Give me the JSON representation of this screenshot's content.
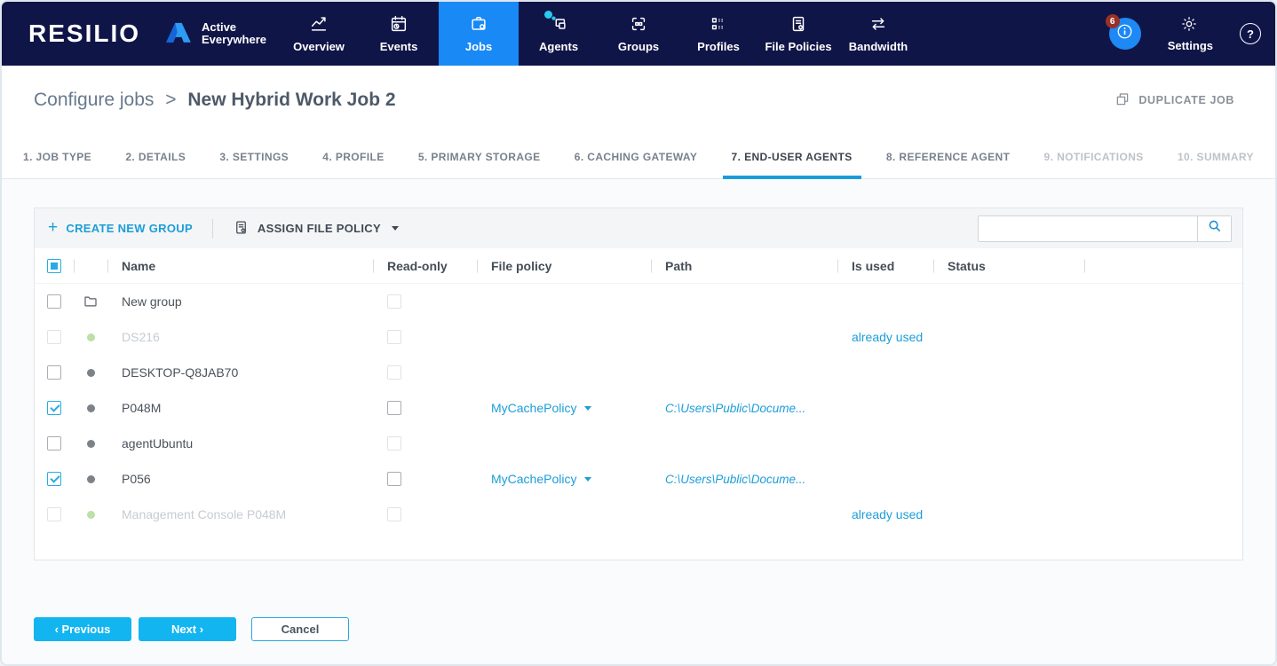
{
  "colors": {
    "navy": "#101548",
    "active_blue": "#1989f5",
    "link_cyan": "#1b9ed9",
    "button_cyan": "#13b5f0",
    "tab_underline": "#1a9cd8",
    "green_dot": "#b3d996",
    "gray_dot": "#7d8288",
    "badge_red": "#993127"
  },
  "brand": {
    "wordmark": "RESILIO",
    "product_line1": "Active",
    "product_line2": "Everywhere"
  },
  "nav": {
    "items": [
      {
        "label": "Overview",
        "icon": "chart-icon",
        "active": false,
        "dot": false
      },
      {
        "label": "Events",
        "icon": "calendar-icon",
        "active": false,
        "dot": false
      },
      {
        "label": "Jobs",
        "icon": "briefcase-icon",
        "active": true,
        "dot": false
      },
      {
        "label": "Agents",
        "icon": "devices-icon",
        "active": false,
        "dot": true
      },
      {
        "label": "Groups",
        "icon": "selection-icon",
        "active": false,
        "dot": false
      },
      {
        "label": "Profiles",
        "icon": "list-icon",
        "active": false,
        "dot": false
      },
      {
        "label": "File Policies",
        "icon": "document-gear-icon",
        "active": false,
        "dot": false
      },
      {
        "label": "Bandwidth",
        "icon": "arrows-icon",
        "active": false,
        "dot": false
      }
    ],
    "notification_badge": "6",
    "settings_label": "Settings",
    "help_glyph": "?"
  },
  "header": {
    "breadcrumb_parent": "Configure jobs",
    "breadcrumb_separator": ">",
    "title": "New Hybrid Work Job 2",
    "duplicate_label": "DUPLICATE JOB"
  },
  "wizard": {
    "steps": [
      {
        "label": "1. JOB TYPE",
        "state": "normal"
      },
      {
        "label": "2. DETAILS",
        "state": "normal"
      },
      {
        "label": "3. SETTINGS",
        "state": "normal"
      },
      {
        "label": "4. PROFILE",
        "state": "normal"
      },
      {
        "label": "5. PRIMARY STORAGE",
        "state": "normal"
      },
      {
        "label": "6. CACHING GATEWAY",
        "state": "normal"
      },
      {
        "label": "7. END-USER AGENTS",
        "state": "active"
      },
      {
        "label": "8. REFERENCE AGENT",
        "state": "normal"
      },
      {
        "label": "9. NOTIFICATIONS",
        "state": "disabled"
      },
      {
        "label": "10. SUMMARY",
        "state": "disabled"
      }
    ]
  },
  "toolbar": {
    "create_plus": "+",
    "create_group_label": "CREATE NEW GROUP",
    "assign_policy_label": "ASSIGN FILE POLICY",
    "search_value": ""
  },
  "table": {
    "columns": [
      "Name",
      "Read-only",
      "File policy",
      "Path",
      "Is used",
      "Status"
    ],
    "header_select_state": "indeterminate",
    "rows": [
      {
        "name": "New group",
        "kind": "group",
        "select": "unchecked",
        "disabled": false,
        "readonly": "disabled",
        "file_policy": "",
        "path": "",
        "is_used": "",
        "status": ""
      },
      {
        "name": "DS216",
        "kind": "agent-online",
        "select": "disabled",
        "disabled": true,
        "readonly": "disabled",
        "file_policy": "",
        "path": "",
        "is_used": "already used",
        "status": ""
      },
      {
        "name": "DESKTOP-Q8JAB70",
        "kind": "agent-offline",
        "select": "unchecked",
        "disabled": false,
        "readonly": "disabled",
        "file_policy": "",
        "path": "",
        "is_used": "",
        "status": ""
      },
      {
        "name": "P048M",
        "kind": "agent-offline",
        "select": "checked",
        "disabled": false,
        "readonly": "unchecked",
        "file_policy": "MyCachePolicy",
        "path": "C:\\Users\\Public\\Docume...",
        "is_used": "",
        "status": ""
      },
      {
        "name": "agentUbuntu",
        "kind": "agent-offline",
        "select": "unchecked",
        "disabled": false,
        "readonly": "disabled",
        "file_policy": "",
        "path": "",
        "is_used": "",
        "status": ""
      },
      {
        "name": "P056",
        "kind": "agent-offline",
        "select": "checked",
        "disabled": false,
        "readonly": "unchecked",
        "file_policy": "MyCachePolicy",
        "path": "C:\\Users\\Public\\Docume...",
        "is_used": "",
        "status": ""
      },
      {
        "name": "Management Console P048M",
        "kind": "agent-online",
        "select": "disabled",
        "disabled": true,
        "readonly": "disabled",
        "file_policy": "",
        "path": "",
        "is_used": "already used",
        "status": ""
      }
    ]
  },
  "footer": {
    "previous_label": "‹ Previous",
    "next_label": "Next ›",
    "cancel_label": "Cancel"
  }
}
